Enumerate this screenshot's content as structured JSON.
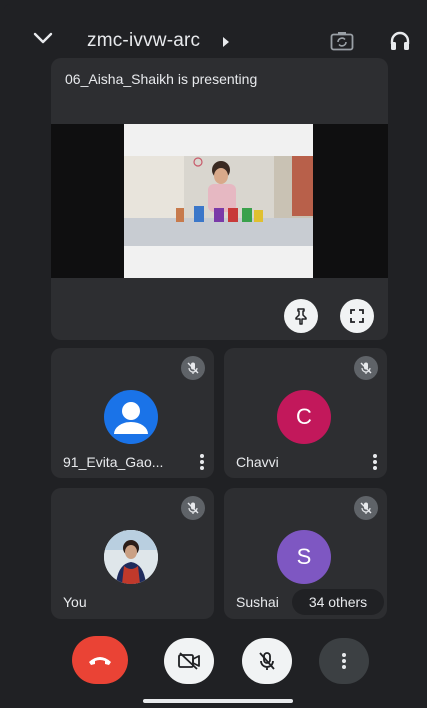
{
  "header": {
    "meeting_code": "zmc-ivvw-arc",
    "icons": [
      "chevron-down-icon",
      "caret-right-icon",
      "switch-camera-icon",
      "headphones-icon"
    ]
  },
  "presentation": {
    "label": "06_Aisha_Shaikh is presenting",
    "icons": [
      "pin-icon",
      "fullscreen-icon"
    ]
  },
  "participants": [
    {
      "name": "91_Evita_Gao...",
      "avatar_type": "generic-person",
      "avatar_color": "#1a73e8",
      "muted": true
    },
    {
      "name": "Chavvi",
      "initial": "C",
      "avatar_color": "#c2185b",
      "muted": true
    },
    {
      "name": "You",
      "avatar_type": "photo",
      "muted": true
    },
    {
      "name": "Sushai",
      "initial": "S",
      "avatar_color": "#7e57c2",
      "muted": true
    }
  ],
  "others_label": "34 others",
  "controls": {
    "icons": [
      "end-call-icon",
      "camera-off-icon",
      "mic-off-icon",
      "more-vert-icon"
    ],
    "colors": {
      "end_call": "#ea4335",
      "light_button": "#f1f3f4",
      "dark_button": "#3c4043"
    }
  }
}
